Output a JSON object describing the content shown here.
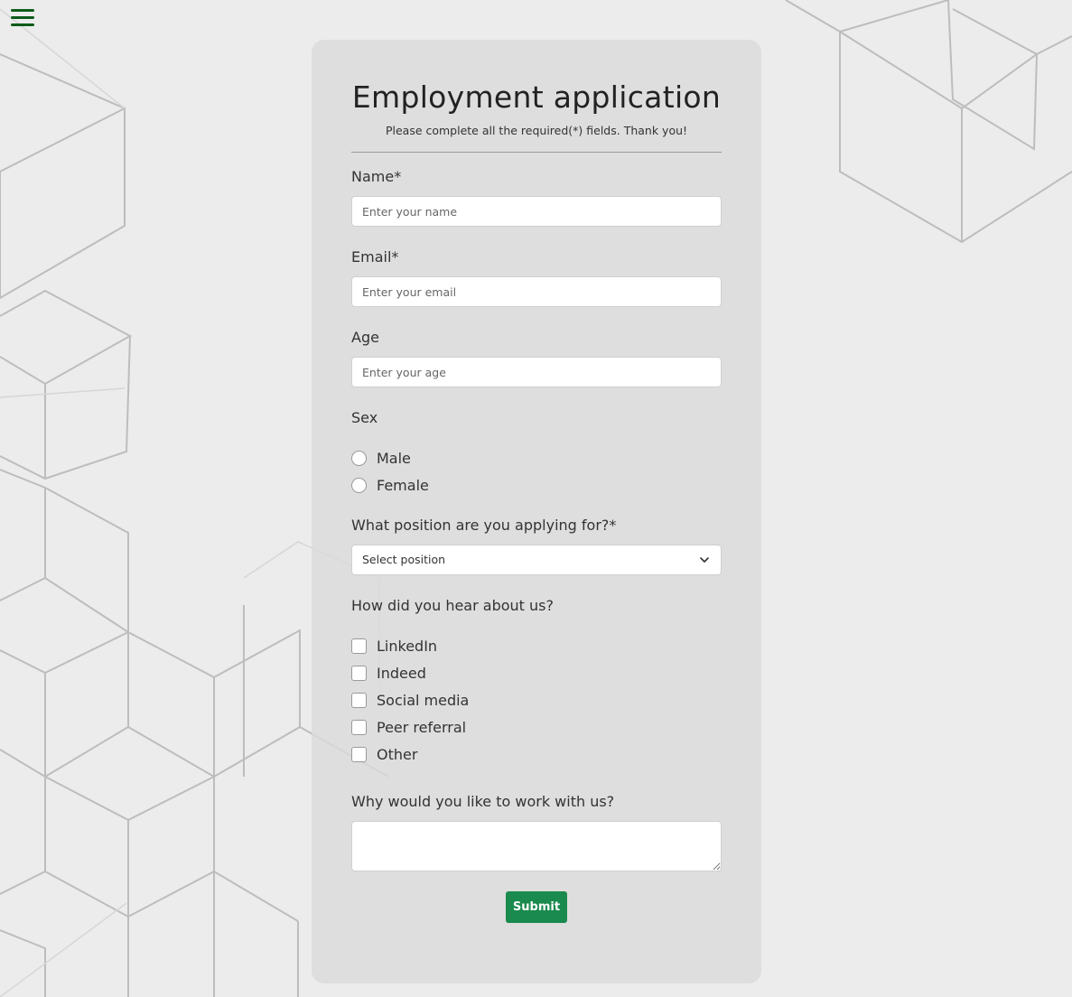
{
  "form": {
    "title": "Employment application",
    "subtitle": "Please complete all the required(*) fields. Thank you!",
    "name": {
      "label": "Name*",
      "placeholder": "Enter your name"
    },
    "email": {
      "label": "Email*",
      "placeholder": "Enter your email"
    },
    "age": {
      "label": "Age",
      "placeholder": "Enter your age"
    },
    "sex": {
      "label": "Sex",
      "options": [
        "Male",
        "Female"
      ]
    },
    "position": {
      "label": "What position are you applying for?*",
      "selected": "Select position"
    },
    "source": {
      "label": "How did you hear about us?",
      "options": [
        "LinkedIn",
        "Indeed",
        "Social media",
        "Peer referral",
        "Other"
      ]
    },
    "reason": {
      "label": "Why would you like to work with us?"
    },
    "submit_label": "Submit"
  },
  "colors": {
    "background": "#ececec",
    "card": "#dadada",
    "menu_icon": "#0b5b18",
    "submit": "#1a8a4e"
  },
  "icons": [
    "hamburger-menu-icon",
    "chevron-down-icon"
  ]
}
